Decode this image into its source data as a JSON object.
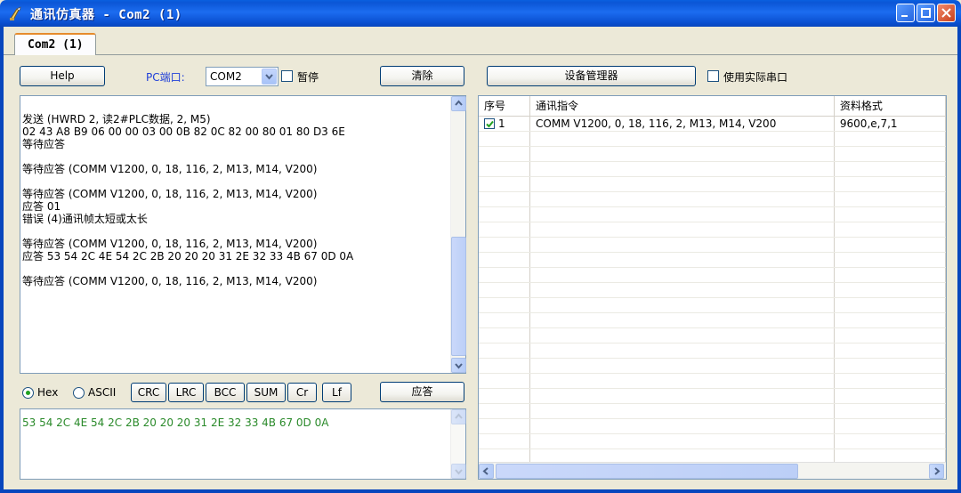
{
  "window": {
    "title": "通讯仿真器 - Com2 (1)"
  },
  "tabs": [
    {
      "label": "Com2 (1)"
    }
  ],
  "toolbar": {
    "help_label": "Help",
    "pc_port_label": "PC端口:",
    "port_value": "COM2",
    "pause_label": "暂停",
    "clear_label": "清除",
    "device_manager_label": "设备管理器",
    "use_real_port_label": "使用实际串口"
  },
  "log": {
    "lines": [
      "发送 (HWRD 2, 读2#PLC数据, 2, M5)",
      "02 43 A8 B9 06 00 00 03 00 0B 82 0C 82 00 80 01 80 D3 6E",
      "等待应答",
      "",
      "等待应答 (COMM V1200, 0, 18, 116, 2, M13, M14, V200)",
      "",
      "等待应答 (COMM V1200, 0, 18, 116, 2, M13, M14, V200)",
      "应答 01",
      "错误 (4)通讯帧太短或太长",
      "",
      "等待应答 (COMM V1200, 0, 18, 116, 2, M13, M14, V200)",
      "应答 53 54 2C 4E 54 2C 2B 20 20 20 31 2E 32 33 4B 67 0D 0A",
      "",
      "等待应答 (COMM V1200, 0, 18, 116, 2, M13, M14, V200)"
    ]
  },
  "reply_bar": {
    "hex_label": "Hex",
    "ascii_label": "ASCII",
    "buttons": [
      "CRC",
      "LRC",
      "BCC",
      "SUM",
      "Cr",
      "Lf"
    ],
    "reply_label": "应答"
  },
  "reply_input": {
    "value": "53 54 2C 4E 54 2C 2B 20 20 20 31 2E 32 33 4B 67 0D 0A"
  },
  "grid": {
    "columns": [
      "序号",
      "通讯指令",
      "资料格式"
    ],
    "rows": [
      {
        "no": "1",
        "checked": true,
        "command": "COMM V1200, 0, 18, 116, 2, M13, M14, V200",
        "format": "9600,e,7,1"
      }
    ]
  },
  "colors": {
    "titlebar": "#0a5fe0",
    "accent_label": "#1f3fd8",
    "hex_text": "#2a8a2a"
  }
}
